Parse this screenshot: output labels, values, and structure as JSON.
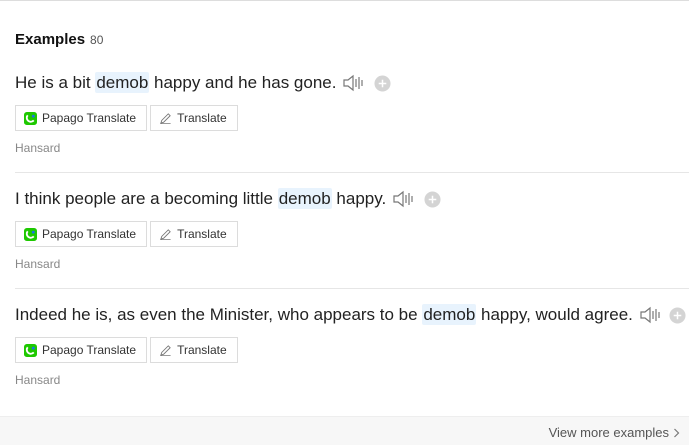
{
  "header": {
    "title": "Examples",
    "count": "80"
  },
  "buttons": {
    "papago": "Papago Translate",
    "translate": "Translate"
  },
  "examples": [
    {
      "before": "He is a bit ",
      "highlight": "demob",
      "after": " happy and he has gone.",
      "source": "Hansard"
    },
    {
      "before": "I think people are a becoming little ",
      "highlight": "demob",
      "after": " happy.",
      "source": "Hansard"
    },
    {
      "before": "Indeed he is, as even the Minister, who appears to be ",
      "highlight": "demob",
      "after": " happy, would agree.",
      "source": "Hansard"
    }
  ],
  "footer": {
    "more_label": "View more examples"
  },
  "colors": {
    "highlight_bg": "#e8f3fd",
    "papago_green": "#1ec800",
    "papago_blue": "#1a73e8"
  },
  "icons": {
    "speaker": "speaker-icon",
    "add": "plus-circle-icon",
    "papago": "papago-logo-icon",
    "pencil": "pencil-icon",
    "chevron": "chevron-right-icon"
  }
}
